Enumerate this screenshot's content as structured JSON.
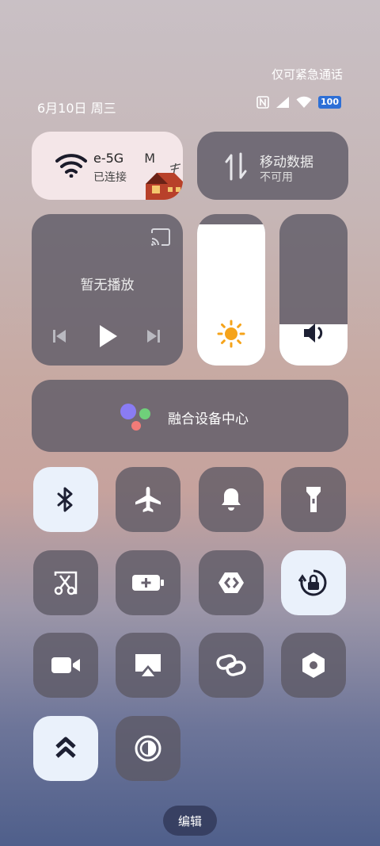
{
  "status": {
    "emergency": "仅可紧急通话",
    "date": "6月10日 周三",
    "battery": "100"
  },
  "wifi": {
    "name": "e-5G",
    "trailing": "M",
    "status": "已连接"
  },
  "mobile": {
    "title": "移动数据",
    "subtitle": "不可用"
  },
  "media": {
    "label": "暂无播放"
  },
  "sliders": {
    "brightness_level": 0.93,
    "volume_level": 0.27
  },
  "hub": {
    "label": "融合设备中心"
  },
  "toggles": [
    {
      "name": "bluetooth",
      "on": true
    },
    {
      "name": "airplane-mode",
      "on": false
    },
    {
      "name": "ring-bell",
      "on": false
    },
    {
      "name": "flashlight",
      "on": false
    },
    {
      "name": "screenshot",
      "on": false
    },
    {
      "name": "battery-saver",
      "on": false
    },
    {
      "name": "nearby-share",
      "on": false
    },
    {
      "name": "rotation-lock",
      "on": true
    },
    {
      "name": "screen-record",
      "on": false
    },
    {
      "name": "screen-cast",
      "on": false
    },
    {
      "name": "link",
      "on": false
    },
    {
      "name": "settings-hex",
      "on": false
    },
    {
      "name": "performance-mode",
      "on": true
    },
    {
      "name": "dark-mode",
      "on": false
    }
  ],
  "edit": {
    "label": "编辑"
  }
}
